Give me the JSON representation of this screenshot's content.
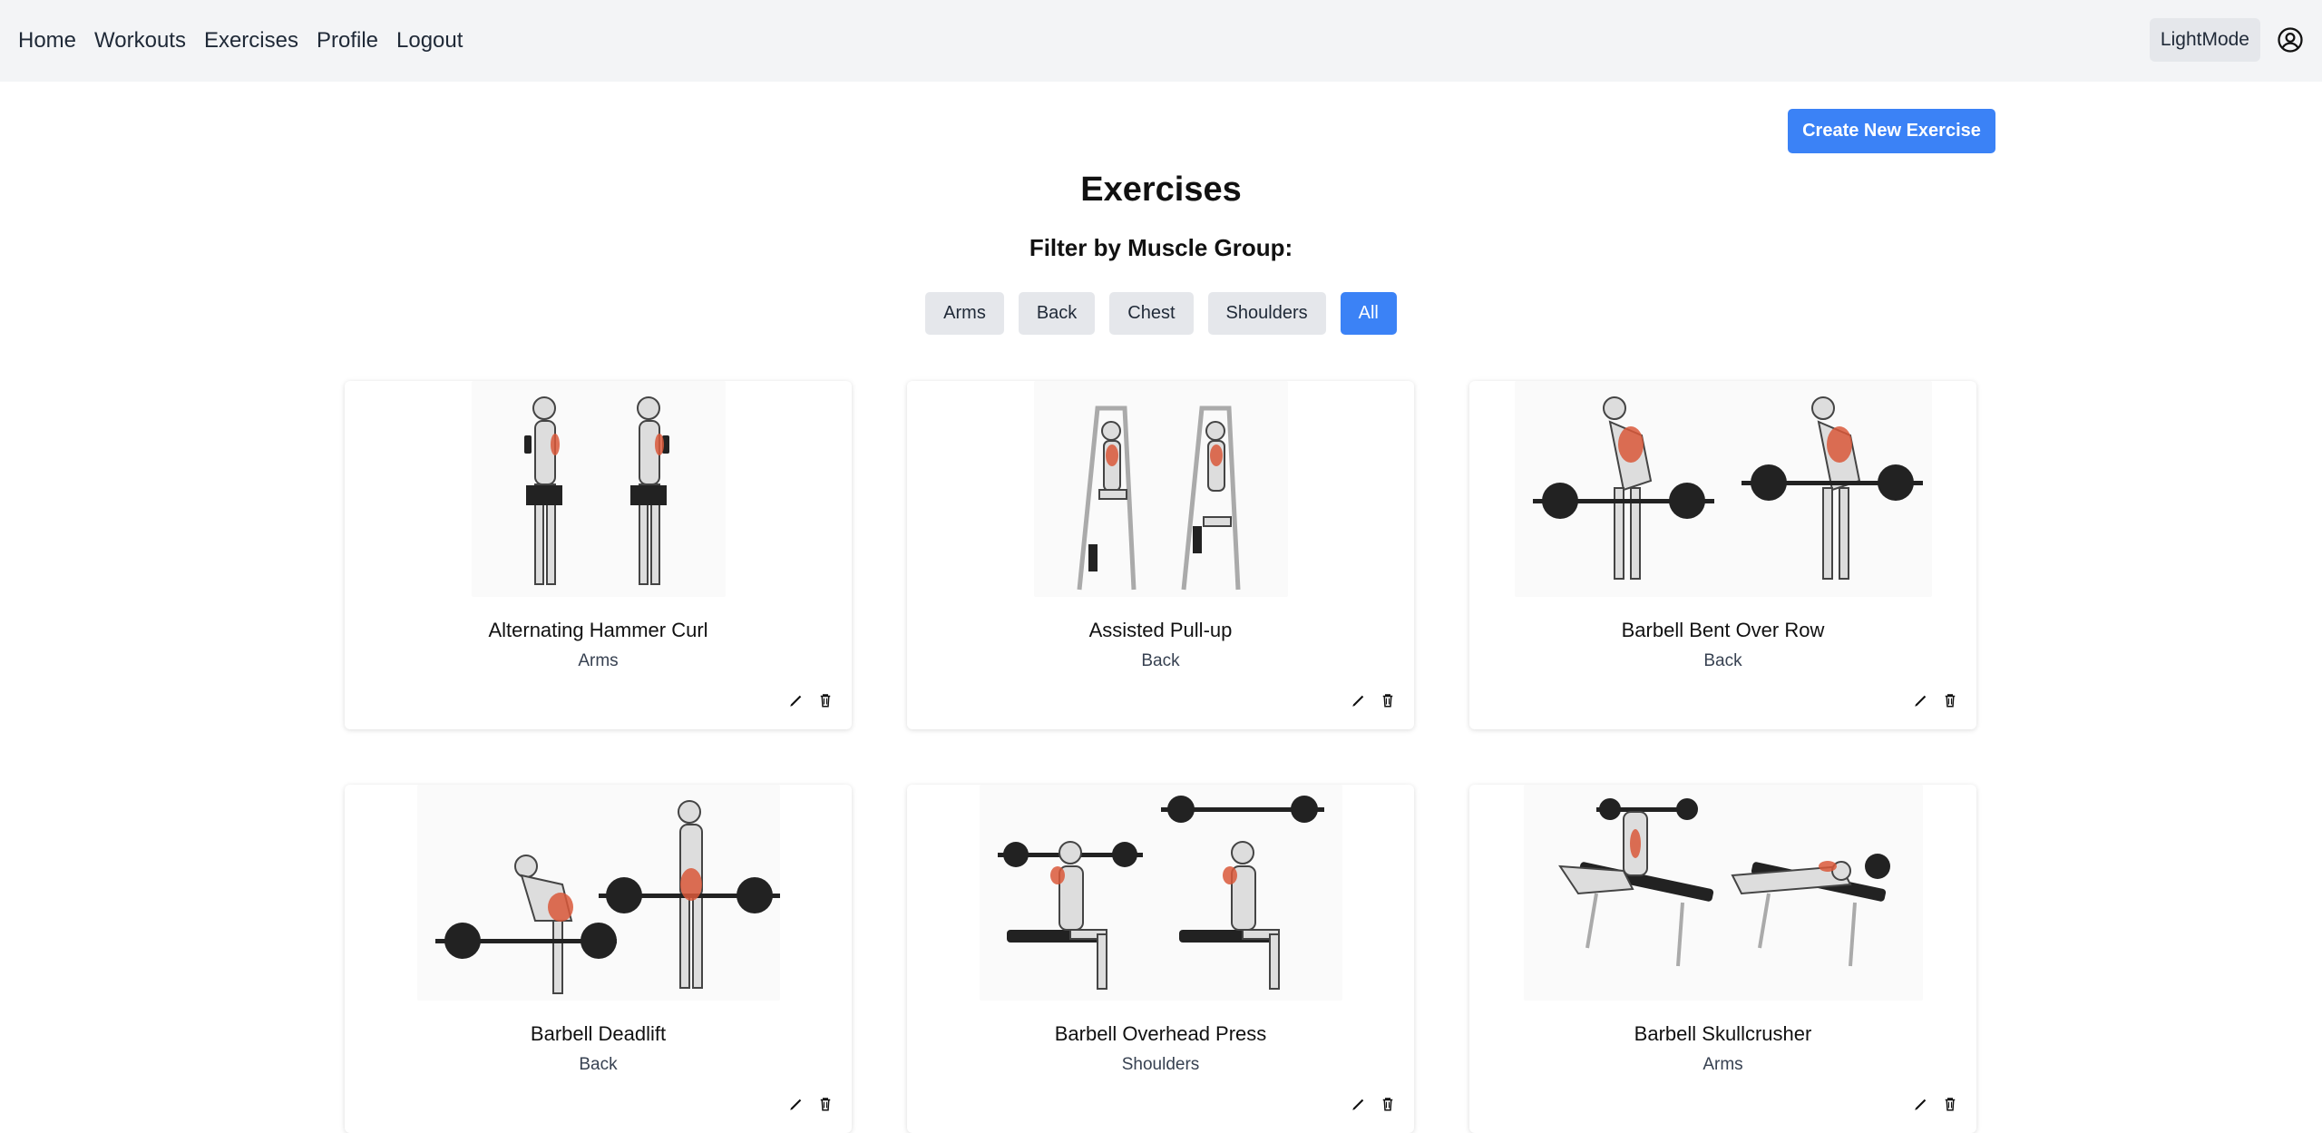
{
  "nav": {
    "links": [
      "Home",
      "Workouts",
      "Exercises",
      "Profile",
      "Logout"
    ],
    "theme_toggle": "LightMode",
    "user_icon": "user-circle-icon"
  },
  "actions": {
    "create_label": "Create New Exercise"
  },
  "page": {
    "title": "Exercises",
    "filter_label": "Filter by Muscle Group:"
  },
  "filters": {
    "options": [
      "Arms",
      "Back",
      "Chest",
      "Shoulders",
      "All"
    ],
    "selected": "All"
  },
  "exercises": [
    {
      "name": "Alternating Hammer Curl",
      "group": "Arms"
    },
    {
      "name": "Assisted Pull-up",
      "group": "Back"
    },
    {
      "name": "Barbell Bent Over Row",
      "group": "Back"
    },
    {
      "name": "Barbell Deadlift",
      "group": "Back"
    },
    {
      "name": "Barbell Overhead Press",
      "group": "Shoulders"
    },
    {
      "name": "Barbell Skullcrusher",
      "group": "Arms"
    }
  ],
  "icons": {
    "edit": "pencil-icon",
    "delete": "trash-icon"
  },
  "colors": {
    "accent": "#3b82f6",
    "nav_bg": "#f3f4f6",
    "chip_bg": "#e5e7eb"
  }
}
